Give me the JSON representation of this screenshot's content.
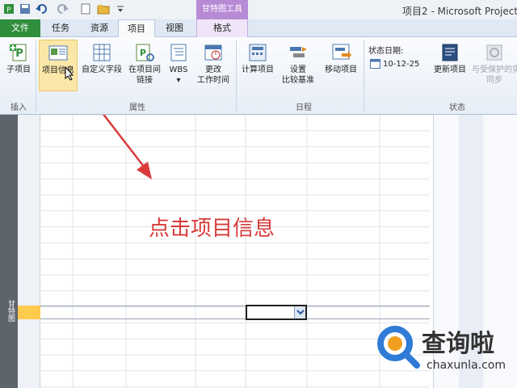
{
  "titlebar": {
    "window_title": "项目2 - Microsoft Project",
    "contextual_tools": "甘特图工具"
  },
  "tabs": {
    "file": "文件",
    "task": "任务",
    "resource": "资源",
    "project": "项目",
    "view": "视图",
    "format": "格式"
  },
  "ribbon": {
    "insert_group": {
      "label": "插入",
      "subproject": "子项目"
    },
    "properties_group": {
      "label": "属性",
      "project_info": "项目信息",
      "custom_fields": "自定义字段",
      "links_between_projects_l1": "在项目间",
      "links_between_projects_l2": "链接",
      "wbs": "WBS",
      "change_working_time_l1": "更改",
      "change_working_time_l2": "工作时间"
    },
    "schedule_group": {
      "label": "日程",
      "calculate_project": "计算项目",
      "set_baseline_l1": "设置",
      "set_baseline_l2": "比较基准",
      "move_project": "移动项目"
    },
    "status_group": {
      "label": "状态",
      "status_date_label": "状态日期:",
      "status_date_value": "10-12-25",
      "update_project": "更新项目",
      "sync_l1": "与受保护的实",
      "sync_l2": "同步"
    }
  },
  "workarea": {
    "side_label": "甘特图",
    "annotation": "点击项目信息"
  },
  "watermark": {
    "cn": "查询啦",
    "en": "chaxunla.com"
  },
  "colors": {
    "file_tab": "#2f8f3c",
    "contextual_tab": "#b78ad6",
    "annotation_red": "#d93a3a",
    "selected_row": "#ffcb4d",
    "highlight_button": "#fbe7a8"
  }
}
